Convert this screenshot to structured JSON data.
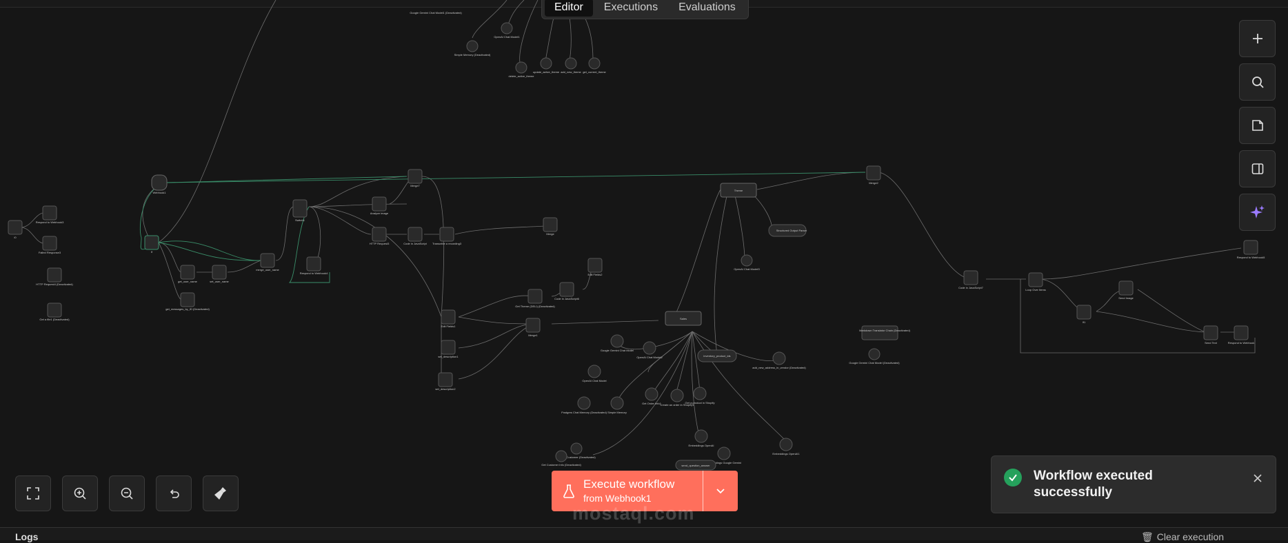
{
  "tabs": [
    {
      "label": "Editor",
      "active": true
    },
    {
      "label": "Executions",
      "active": false
    },
    {
      "label": "Evaluations",
      "active": false
    }
  ],
  "execute": {
    "title": "Execute workflow",
    "subtitle": "from Webhook1"
  },
  "toast": {
    "message": "Workflow executed successfully"
  },
  "logs": {
    "title": "Logs",
    "clear_label": "Clear execution"
  },
  "watermark": "mostaql.com",
  "colors": {
    "accent": "#ff6f5c",
    "success": "#25a15c",
    "edge": "#7a7a7a",
    "edge_active": "#3a8f6a"
  },
  "nodes": [
    {
      "label": "Respond to Webhook3"
    },
    {
      "label": "Failed Response3"
    },
    {
      "label": "HTTP Request4 (Deactivated)"
    },
    {
      "label": "Get a file1 (Deactivated)"
    },
    {
      "label": "Webhook1"
    },
    {
      "label": "If"
    },
    {
      "label": "get_user_name"
    },
    {
      "label": "set_user_name"
    },
    {
      "label": "get_messages_by_ID (Deactivated)"
    },
    {
      "label": "merge_user_name"
    },
    {
      "label": "Switch1"
    },
    {
      "label": "Respond to Webhook4"
    },
    {
      "label": "Analyze image"
    },
    {
      "label": "Merge7"
    },
    {
      "label": "HTTP Request3"
    },
    {
      "label": "Code in JavaScript"
    },
    {
      "label": "Transcribe a recording3"
    },
    {
      "label": "Merge"
    },
    {
      "label": "Edit Fields1"
    },
    {
      "label": "set_description1"
    },
    {
      "label": "set_description2"
    },
    {
      "label": "Get Theme (DELI) (Deactivated)"
    },
    {
      "label": "Code in JavaScript6"
    },
    {
      "label": "Edit Fields2"
    },
    {
      "label": "Merge1"
    },
    {
      "label": "Sales"
    },
    {
      "label": "Google Gemini Chat Model"
    },
    {
      "label": "OpenAI Chat Model2"
    },
    {
      "label": "OpenAI Chat Model"
    },
    {
      "label": "Postgres Chat Memory (Deactivated)"
    },
    {
      "label": "Simple Memory"
    },
    {
      "label": "Get Order Info1"
    },
    {
      "label": "Create an order in Shopify1"
    },
    {
      "label": "Get a product in Shopify"
    },
    {
      "label": "inventory_product_ids"
    },
    {
      "label": "add_new_address_in_vendor (Deactivated)"
    },
    {
      "label": "Embeddings OpenAI"
    },
    {
      "label": "Embeddings Google Gemini"
    },
    {
      "label": "Embeddings OpenAI1"
    },
    {
      "label": "send_question_answer"
    },
    {
      "label": "Create Customer (Deactivated)"
    },
    {
      "label": "Get Customer Info (Deactivated)"
    },
    {
      "label": "Theme"
    },
    {
      "label": "Structured Output Parser"
    },
    {
      "label": "OpenAI Chat Model3"
    },
    {
      "label": "Merge2"
    },
    {
      "label": "Markdown Translator Chain (Deactivated)"
    },
    {
      "label": "Google Gemini Chat Model (Deactivated)"
    },
    {
      "label": "Code in JavaScript7"
    },
    {
      "label": "Loop Over Items"
    },
    {
      "label": "If1"
    },
    {
      "label": "Send Image"
    },
    {
      "label": "Send Text"
    },
    {
      "label": "Respond to Webhook"
    },
    {
      "label": "Respond to Webhook5"
    },
    {
      "label": "Google Gemini Chat Model1 (Deactivated)"
    },
    {
      "label": "OpenAI Chat Model1"
    },
    {
      "label": "Simple Memory (Deactivated)"
    },
    {
      "label": "delete_active_theme"
    },
    {
      "label": "update_active_theme"
    },
    {
      "label": "add_new_theme"
    },
    {
      "label": "get_current_theme"
    }
  ]
}
